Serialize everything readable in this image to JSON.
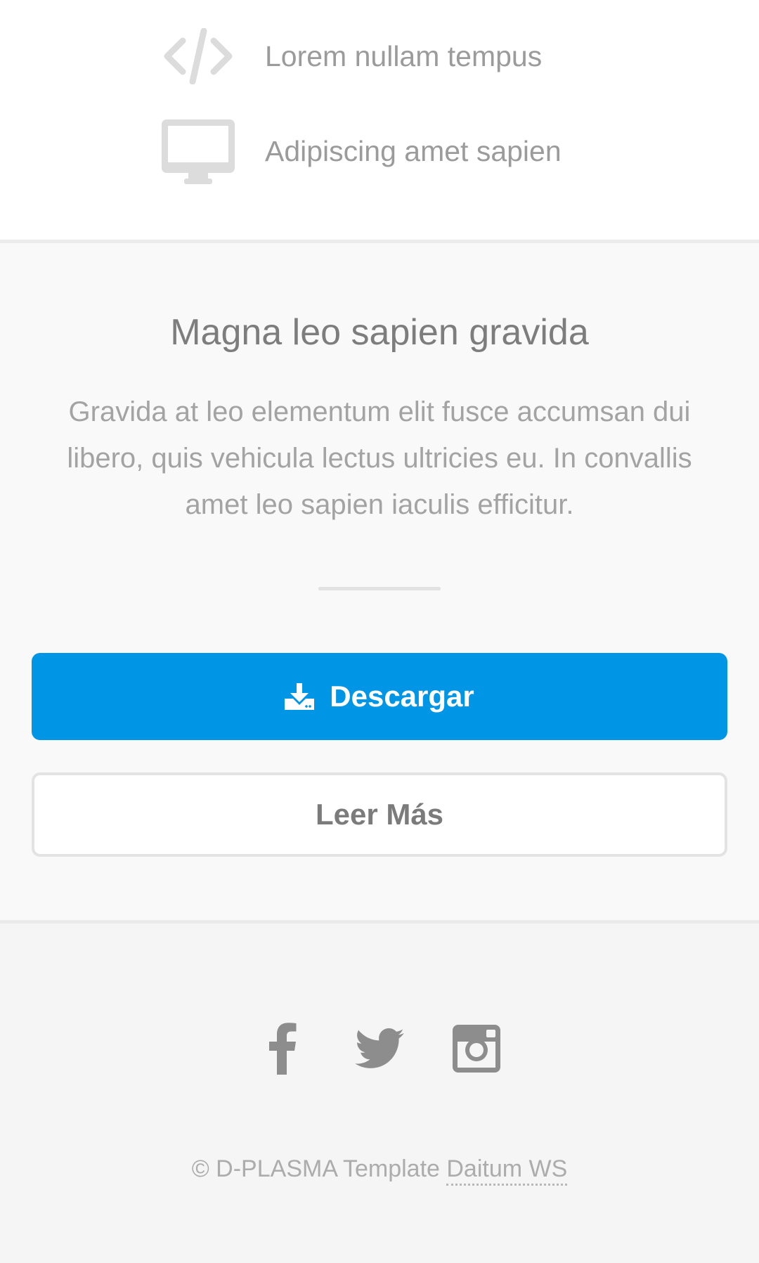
{
  "features": [
    {
      "icon": "code-icon",
      "label": "Lorem nullam tempus"
    },
    {
      "icon": "desktop-icon",
      "label": "Adipiscing amet sapien"
    }
  ],
  "cta": {
    "title": "Magna leo sapien gravida",
    "text": "Gravida at leo elementum elit fusce accumsan dui libero, quis vehicula lectus ultricies eu. In convallis amet leo sapien iaculis efficitur.",
    "download_label": "Descargar",
    "read_more_label": "Leer Más"
  },
  "footer": {
    "socials": [
      "facebook-icon",
      "twitter-icon",
      "instagram-icon"
    ],
    "copyright_prefix": "© D-PLASMA Template",
    "copyright_link": "Daitum WS"
  },
  "colors": {
    "primary": "#0096e5",
    "text_muted": "#9b9b9b",
    "icon_gray": "#dcdcdc",
    "social_gray": "#8d8d8d"
  }
}
